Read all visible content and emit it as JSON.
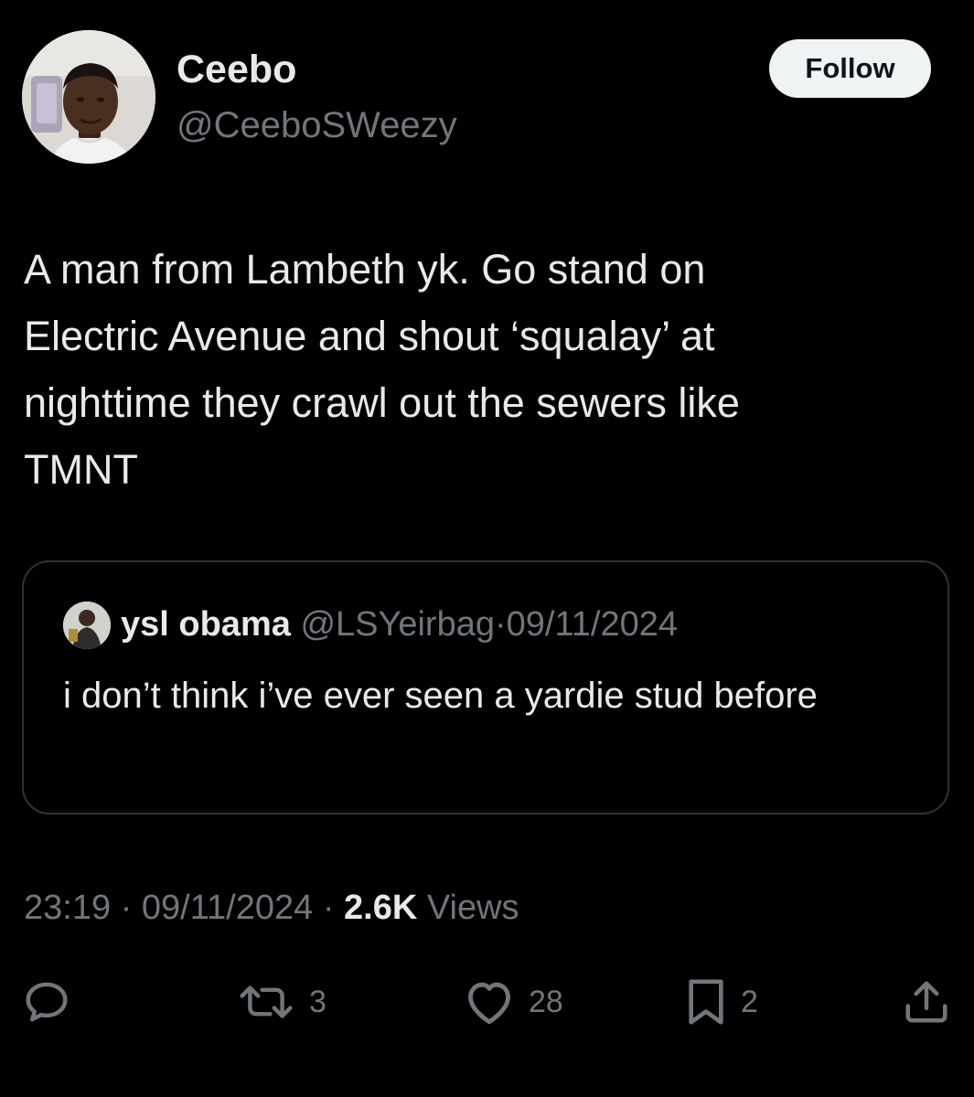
{
  "author": {
    "display_name": "Ceebo",
    "handle": "@CeeboSWeezy",
    "avatar_icon": "profile-photo"
  },
  "follow_button": {
    "label": "Follow"
  },
  "tweet": {
    "text": "A man from Lambeth yk. Go stand on\nElectric Avenue and shout ‘squalay’ at\nnighttime they crawl out the sewers like\nTMNT"
  },
  "quoted_tweet": {
    "display_name": "ysl obama",
    "handle": "@LSYeirbag",
    "separator": "·",
    "date": "09/11/2024",
    "text": "i don’t think i’ve ever seen a yardie stud before",
    "avatar_icon": "profile-photo"
  },
  "meta": {
    "time": "23:19",
    "separator": "·",
    "date": "09/11/2024",
    "views_count": "2.6K",
    "views_label": "Views"
  },
  "actions": {
    "reply": {
      "icon": "reply-icon",
      "count": ""
    },
    "retweet": {
      "icon": "retweet-icon",
      "count": "3"
    },
    "like": {
      "icon": "heart-icon",
      "count": "28"
    },
    "bookmark": {
      "icon": "bookmark-icon",
      "count": "2"
    },
    "share": {
      "icon": "share-icon",
      "count": ""
    }
  },
  "colors": {
    "background": "#000000",
    "primary_text": "#e7e9ea",
    "secondary_text": "#71767b",
    "border": "#2f3336",
    "follow_button_bg": "#eff3f4"
  }
}
